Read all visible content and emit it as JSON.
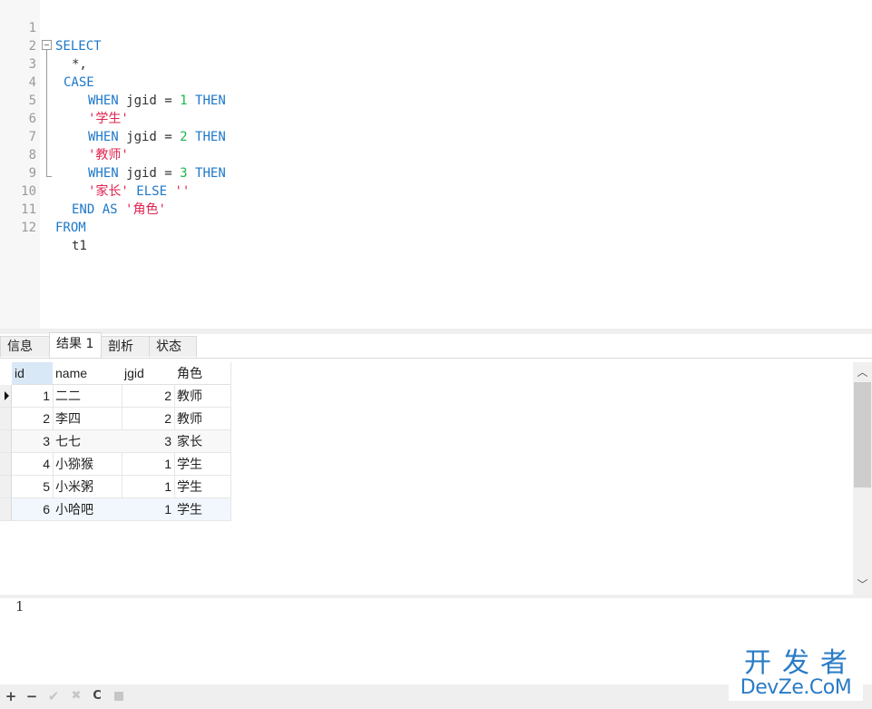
{
  "editor": {
    "lines": [
      {
        "n": "1"
      },
      {
        "n": "2"
      },
      {
        "n": "3"
      },
      {
        "n": "4"
      },
      {
        "n": "5"
      },
      {
        "n": "6"
      },
      {
        "n": "7"
      },
      {
        "n": "8"
      },
      {
        "n": "9"
      },
      {
        "n": "10"
      },
      {
        "n": "11"
      },
      {
        "n": "12"
      }
    ],
    "tokens": {
      "select": "SELECT",
      "star": "*,",
      "case": "CASE",
      "when": "WHEN",
      "jgid_eq": " jgid = ",
      "then": "THEN",
      "v1": "1",
      "v2": "2",
      "v3": "3",
      "s_student": "'学生'",
      "s_teacher": "'教师'",
      "s_parent": "'家长'",
      "else": "ELSE",
      "empty_str": "''",
      "end": "END",
      "as": "AS",
      "s_role": "'角色'",
      "from": "FROM",
      "table": "t1"
    }
  },
  "tabs": [
    {
      "label": "信息",
      "active": false
    },
    {
      "label": "结果 1",
      "active": true
    },
    {
      "label": "剖析",
      "active": false
    },
    {
      "label": "状态",
      "active": false
    }
  ],
  "grid": {
    "columns": [
      "id",
      "name",
      "jgid",
      "角色"
    ],
    "rows": [
      {
        "id": "1",
        "name": "二二",
        "jgid": "2",
        "role": "教师"
      },
      {
        "id": "2",
        "name": "李四",
        "jgid": "2",
        "role": "教师"
      },
      {
        "id": "3",
        "name": "七七",
        "jgid": "3",
        "role": "家长"
      },
      {
        "id": "4",
        "name": "小猕猴",
        "jgid": "1",
        "role": "学生"
      },
      {
        "id": "5",
        "name": "小米粥",
        "jgid": "1",
        "role": "学生"
      },
      {
        "id": "6",
        "name": "小哈吧",
        "jgid": "1",
        "role": "学生"
      }
    ],
    "current_row": 0
  },
  "scrollbar": {
    "up_glyph": "︿",
    "down_glyph": "﹀"
  },
  "preview": {
    "text": "1"
  },
  "toolbar": {
    "add": "+",
    "remove": "−",
    "apply": "✔",
    "discard": "✖",
    "refresh": "C"
  },
  "watermark": {
    "top": "开发者",
    "bottom": "DevZe.CoM"
  }
}
